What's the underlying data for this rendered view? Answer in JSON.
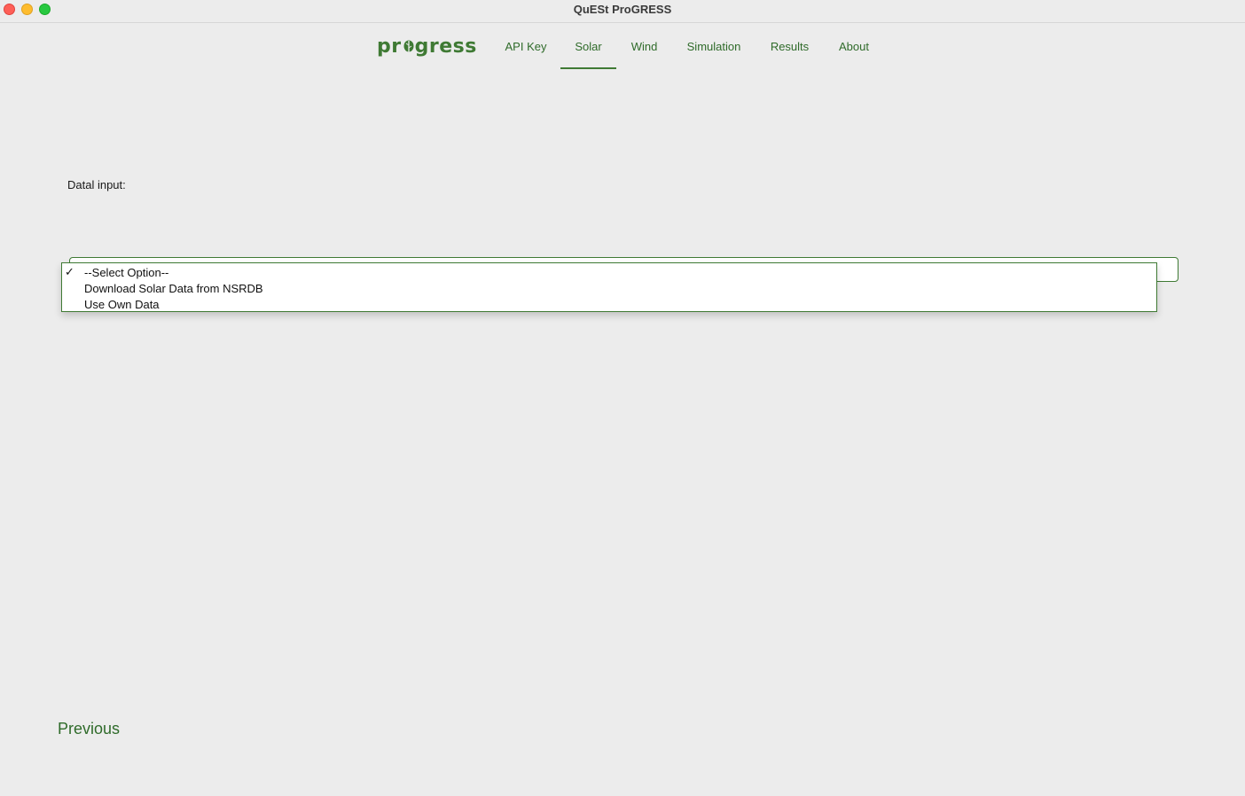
{
  "window": {
    "title": "QuESt ProGRESS"
  },
  "nav": {
    "logo_text_left": "pr",
    "logo_text_right": "gress",
    "tabs": [
      {
        "label": "API Key",
        "active": false
      },
      {
        "label": "Solar",
        "active": true
      },
      {
        "label": "Wind",
        "active": false
      },
      {
        "label": "Simulation",
        "active": false
      },
      {
        "label": "Results",
        "active": false
      },
      {
        "label": "About",
        "active": false
      }
    ]
  },
  "form": {
    "data_input_label": "Datal input:",
    "select": {
      "selected": "--Select Option--",
      "options": [
        {
          "label": "--Select Option--",
          "checked": true
        },
        {
          "label": "Download Solar Data from NSRDB",
          "checked": false
        },
        {
          "label": "Use Own Data",
          "checked": false
        }
      ],
      "check_glyph": "✓"
    }
  },
  "footer": {
    "previous_label": "Previous"
  },
  "colors": {
    "accent": "#3f7a34",
    "background": "#ececec"
  }
}
